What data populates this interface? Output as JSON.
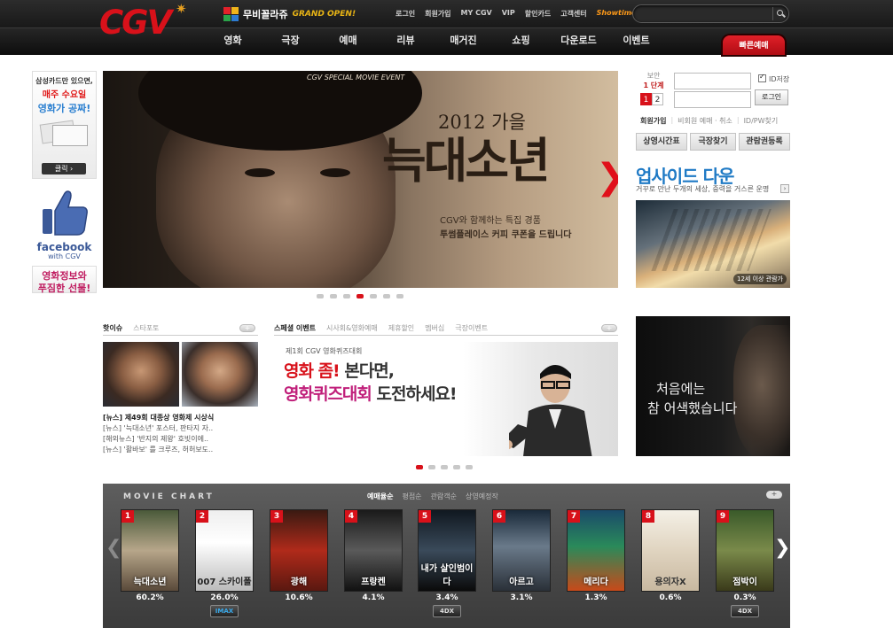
{
  "header": {
    "logo": "CGV",
    "promo": {
      "name": "무비꼴라쥬",
      "status": "GRAND OPEN!"
    },
    "top_links": [
      "로그인",
      "회원가입",
      "MY CGV",
      "VIP",
      "할인카드",
      "고객센터",
      "Showtimes"
    ],
    "search_placeholder": "",
    "nav": [
      "영화",
      "극장",
      "예매",
      "리뷰",
      "매거진",
      "쇼핑",
      "다운로드",
      "이벤트"
    ],
    "quick_booking": "빠른예매"
  },
  "left_ads": {
    "card_ad": {
      "line1": "삼성카드만 있으면,",
      "line2": "매주 수요일",
      "line3": "영화가 공짜!",
      "button": "클릭 ›"
    },
    "facebook": {
      "name": "facebook",
      "with": "with CGV"
    },
    "movie_info": {
      "line1": "영화정보와",
      "line2": "푸짐한 선물!"
    }
  },
  "banner": {
    "event_label": "CGV SPECIAL MOVIE EVENT",
    "year": "2012 가을",
    "title": "늑대소년",
    "desc1": "CGV와 함께하는 특집 경품",
    "desc2": "투썸플레이스 커피 쿠폰을 드립니다",
    "slides": 7,
    "active_slide": 4
  },
  "login": {
    "security_label": "보안",
    "step_label": "1 단계",
    "steps": [
      "1",
      "2"
    ],
    "save_id": "ID저장",
    "button": "로그인",
    "links": [
      "회원가입",
      "비회원 예매 · 취소",
      "ID/PW찾기"
    ],
    "id_placeholder": "",
    "pw_placeholder": ""
  },
  "services": [
    "상영시간표",
    "극장찾기",
    "관람권등록"
  ],
  "upside_down": {
    "title": "업사이드 다운",
    "subtitle": "거꾸로 만난 두개의 세상, 중력을 거스른 운명",
    "rating": "12세 이상 관람가"
  },
  "hot_issue": {
    "tabs": [
      "핫이슈",
      "스타포토"
    ],
    "news": [
      "[뉴스] 제49회 대종상 영화제 시상식",
      "[뉴스] '늑대소년' 포스터, 판타지 자..",
      "[해외뉴스] '반지의 제왕' 호빗이에..",
      "[뉴스] '활바보' 를 크루즈, 허허보도.."
    ]
  },
  "special_event": {
    "tabs": [
      "스페셜 이벤트",
      "시사회&영화예매",
      "제휴할인",
      "멤버십",
      "극장이벤트"
    ],
    "small": "제1회 CGV 영화퀴즈대회",
    "line1_a": "영화 좀!",
    "line1_b": " 본다면,",
    "line2_a": "영화퀴즈대회",
    "line2_b": " 도전하세요!",
    "slides": 5,
    "active_slide": 1
  },
  "right_ad": {
    "line1": "처음에는",
    "line2": "참 어색했습니다"
  },
  "movie_chart": {
    "title": "MOVIE CHART",
    "tabs": [
      "예매율순",
      "평점순",
      "관람객순",
      "상영예정작"
    ],
    "movies": [
      {
        "rank": "1",
        "title": "늑대소년",
        "rate": "60.2%",
        "badge": ""
      },
      {
        "rank": "2",
        "title": "007 스카이폴",
        "rate": "26.0%",
        "badge": "IMAX"
      },
      {
        "rank": "3",
        "title": "광해",
        "rate": "10.6%",
        "badge": ""
      },
      {
        "rank": "4",
        "title": "프랑켄",
        "rate": "4.1%",
        "badge": ""
      },
      {
        "rank": "5",
        "title": "내가 살인범이다",
        "rate": "3.4%",
        "badge": "4DX"
      },
      {
        "rank": "6",
        "title": "아르고",
        "rate": "3.1%",
        "badge": ""
      },
      {
        "rank": "7",
        "title": "메리다",
        "rate": "1.3%",
        "badge": ""
      },
      {
        "rank": "8",
        "title": "용의자X",
        "rate": "0.6%",
        "badge": ""
      },
      {
        "rank": "9",
        "title": "점박이",
        "rate": "0.3%",
        "badge": "4DX"
      }
    ]
  },
  "colors": {
    "brand_red": "#d8111a",
    "accent_blue": "#1f7ac5",
    "showtimes_orange": "#ff9a18"
  }
}
